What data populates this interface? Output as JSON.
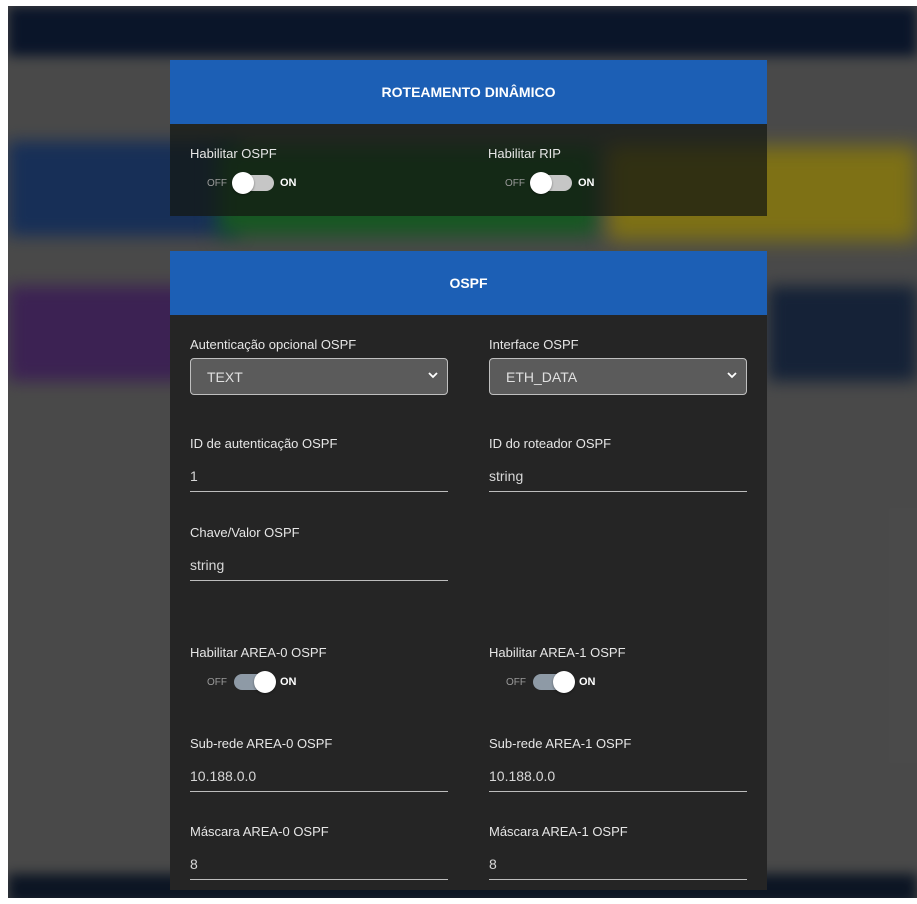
{
  "colors": {
    "header": "#1c5fb5",
    "panel": "#252525"
  },
  "routing": {
    "title": "ROTEAMENTO DINÂMICO",
    "ospf_toggle": {
      "label": "Habilitar OSPF",
      "off": "OFF",
      "on": "ON",
      "value": false
    },
    "rip_toggle": {
      "label": "Habilitar RIP",
      "off": "OFF",
      "on": "ON",
      "value": false
    }
  },
  "ospf": {
    "title": "OSPF",
    "auth_select": {
      "label": "Autenticação opcional OSPF",
      "value": "TEXT"
    },
    "interface_select": {
      "label": "Interface OSPF",
      "value": "ETH_DATA"
    },
    "auth_id": {
      "label": "ID de autenticação OSPF",
      "value": "1"
    },
    "router_id": {
      "label": "ID do roteador OSPF",
      "value": "string"
    },
    "key_value": {
      "label": "Chave/Valor OSPF",
      "value": "string"
    },
    "area0_toggle": {
      "label": "Habilitar AREA-0 OSPF",
      "off": "OFF",
      "on": "ON",
      "value": true
    },
    "area1_toggle": {
      "label": "Habilitar AREA-1 OSPF",
      "off": "OFF",
      "on": "ON",
      "value": true
    },
    "area0_subnet": {
      "label": "Sub-rede AREA-0 OSPF",
      "value": "10.188.0.0"
    },
    "area1_subnet": {
      "label": "Sub-rede AREA-1 OSPF",
      "value": "10.188.0.0"
    },
    "area0_mask": {
      "label": "Máscara AREA-0 OSPF",
      "value": "8"
    },
    "area1_mask": {
      "label": "Máscara AREA-1 OSPF",
      "value": "8"
    }
  }
}
